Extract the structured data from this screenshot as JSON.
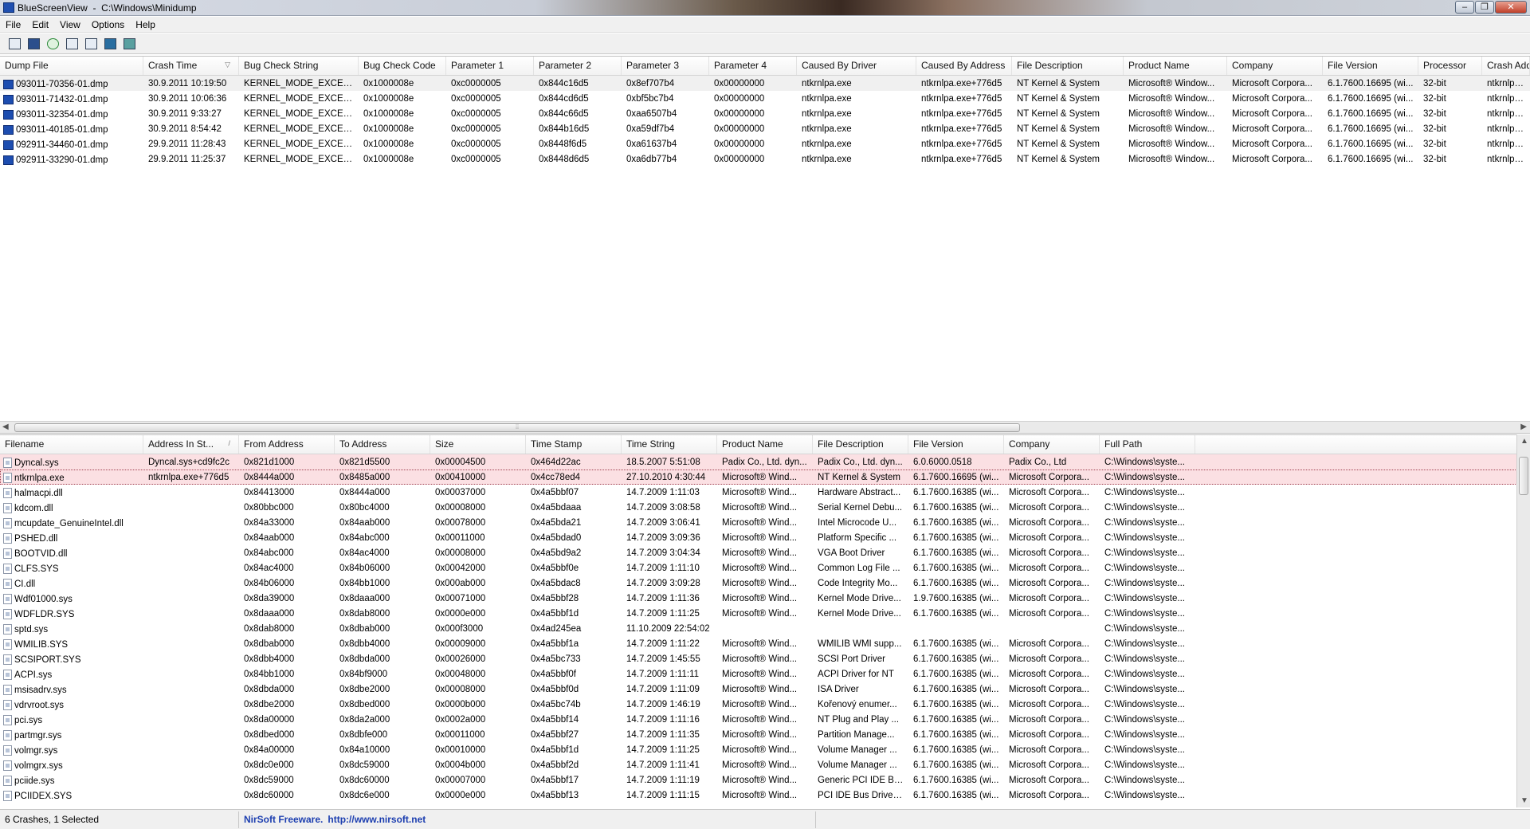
{
  "window": {
    "title": "BlueScreenView  -  C:\\Windows\\Minidump",
    "minimize": "‒",
    "maximize": "❐",
    "close": "✕"
  },
  "menu": [
    "File",
    "Edit",
    "View",
    "Options",
    "Help"
  ],
  "toolbar": [
    "open-folder-icon",
    "save-icon",
    "refresh-icon",
    "copy-icon",
    "properties-icon",
    "html-report-icon",
    "exit-icon"
  ],
  "upper": {
    "columns": [
      "Dump File",
      "Crash Time",
      "Bug Check String",
      "Bug Check Code",
      "Parameter 1",
      "Parameter 2",
      "Parameter 3",
      "Parameter 4",
      "Caused By Driver",
      "Caused By Address",
      "File Description",
      "Product Name",
      "Company",
      "File Version",
      "Processor",
      "Crash Add"
    ],
    "sort_arrow": "▽",
    "rows": [
      [
        "093011-70356-01.dmp",
        "30.9.2011 10:19:50",
        "KERNEL_MODE_EXCEPTI...",
        "0x1000008e",
        "0xc0000005",
        "0x844c16d5",
        "0x8ef707b4",
        "0x00000000",
        "ntkrnlpa.exe",
        "ntkrnlpa.exe+776d5",
        "NT Kernel & System",
        "Microsoft® Window...",
        "Microsoft Corpora...",
        "6.1.7600.16695 (wi...",
        "32-bit",
        "ntkrnlpa.e"
      ],
      [
        "093011-71432-01.dmp",
        "30.9.2011 10:06:36",
        "KERNEL_MODE_EXCEPTI...",
        "0x1000008e",
        "0xc0000005",
        "0x844cd6d5",
        "0xbf5bc7b4",
        "0x00000000",
        "ntkrnlpa.exe",
        "ntkrnlpa.exe+776d5",
        "NT Kernel & System",
        "Microsoft® Window...",
        "Microsoft Corpora...",
        "6.1.7600.16695 (wi...",
        "32-bit",
        "ntkrnlpa.e"
      ],
      [
        "093011-32354-01.dmp",
        "30.9.2011 9:33:27",
        "KERNEL_MODE_EXCEPTI...",
        "0x1000008e",
        "0xc0000005",
        "0x844c66d5",
        "0xaa6507b4",
        "0x00000000",
        "ntkrnlpa.exe",
        "ntkrnlpa.exe+776d5",
        "NT Kernel & System",
        "Microsoft® Window...",
        "Microsoft Corpora...",
        "6.1.7600.16695 (wi...",
        "32-bit",
        "ntkrnlpa.e"
      ],
      [
        "093011-40185-01.dmp",
        "30.9.2011 8:54:42",
        "KERNEL_MODE_EXCEPTI...",
        "0x1000008e",
        "0xc0000005",
        "0x844b16d5",
        "0xa59df7b4",
        "0x00000000",
        "ntkrnlpa.exe",
        "ntkrnlpa.exe+776d5",
        "NT Kernel & System",
        "Microsoft® Window...",
        "Microsoft Corpora...",
        "6.1.7600.16695 (wi...",
        "32-bit",
        "ntkrnlpa.e"
      ],
      [
        "092911-34460-01.dmp",
        "29.9.2011 11:28:43",
        "KERNEL_MODE_EXCEPTI...",
        "0x1000008e",
        "0xc0000005",
        "0x8448f6d5",
        "0xa61637b4",
        "0x00000000",
        "ntkrnlpa.exe",
        "ntkrnlpa.exe+776d5",
        "NT Kernel & System",
        "Microsoft® Window...",
        "Microsoft Corpora...",
        "6.1.7600.16695 (wi...",
        "32-bit",
        "ntkrnlpa.e"
      ],
      [
        "092911-33290-01.dmp",
        "29.9.2011 11:25:37",
        "KERNEL_MODE_EXCEPTI...",
        "0x1000008e",
        "0xc0000005",
        "0x8448d6d5",
        "0xa6db77b4",
        "0x00000000",
        "ntkrnlpa.exe",
        "ntkrnlpa.exe+776d5",
        "NT Kernel & System",
        "Microsoft® Window...",
        "Microsoft Corpora...",
        "6.1.7600.16695 (wi...",
        "32-bit",
        "ntkrnlpa.e"
      ]
    ]
  },
  "lower": {
    "columns": [
      "Filename",
      "Address In St...",
      "From Address",
      "To Address",
      "Size",
      "Time Stamp",
      "Time String",
      "Product Name",
      "File Description",
      "File Version",
      "Company",
      "Full Path"
    ],
    "sort_arrow": "/",
    "rows": [
      [
        "Dyncal.sys",
        "Dyncal.sys+cd9fc2c",
        "0x821d1000",
        "0x821d5500",
        "0x00004500",
        "0x464d22ac",
        "18.5.2007 5:51:08",
        "Padix Co., Ltd. dyn...",
        "Padix Co., Ltd. dyn...",
        "6.0.6000.0518",
        "Padix Co., Ltd",
        "C:\\Windows\\syste..."
      ],
      [
        "ntkrnlpa.exe",
        "ntkrnlpa.exe+776d5",
        "0x8444a000",
        "0x8485a000",
        "0x00410000",
        "0x4cc78ed4",
        "27.10.2010 4:30:44",
        "Microsoft® Wind...",
        "NT Kernel & System",
        "6.1.7600.16695 (wi...",
        "Microsoft Corpora...",
        "C:\\Windows\\syste..."
      ],
      [
        "halmacpi.dll",
        "",
        "0x84413000",
        "0x8444a000",
        "0x00037000",
        "0x4a5bbf07",
        "14.7.2009 1:11:03",
        "Microsoft® Wind...",
        "Hardware Abstract...",
        "6.1.7600.16385 (wi...",
        "Microsoft Corpora...",
        "C:\\Windows\\syste..."
      ],
      [
        "kdcom.dll",
        "",
        "0x80bbc000",
        "0x80bc4000",
        "0x00008000",
        "0x4a5bdaaa",
        "14.7.2009 3:08:58",
        "Microsoft® Wind...",
        "Serial Kernel Debu...",
        "6.1.7600.16385 (wi...",
        "Microsoft Corpora...",
        "C:\\Windows\\syste..."
      ],
      [
        "mcupdate_GenuineIntel.dll",
        "",
        "0x84a33000",
        "0x84aab000",
        "0x00078000",
        "0x4a5bda21",
        "14.7.2009 3:06:41",
        "Microsoft® Wind...",
        "Intel Microcode U...",
        "6.1.7600.16385 (wi...",
        "Microsoft Corpora...",
        "C:\\Windows\\syste..."
      ],
      [
        "PSHED.dll",
        "",
        "0x84aab000",
        "0x84abc000",
        "0x00011000",
        "0x4a5bdad0",
        "14.7.2009 3:09:36",
        "Microsoft® Wind...",
        "Platform Specific ...",
        "6.1.7600.16385 (wi...",
        "Microsoft Corpora...",
        "C:\\Windows\\syste..."
      ],
      [
        "BOOTVID.dll",
        "",
        "0x84abc000",
        "0x84ac4000",
        "0x00008000",
        "0x4a5bd9a2",
        "14.7.2009 3:04:34",
        "Microsoft® Wind...",
        "VGA Boot Driver",
        "6.1.7600.16385 (wi...",
        "Microsoft Corpora...",
        "C:\\Windows\\syste..."
      ],
      [
        "CLFS.SYS",
        "",
        "0x84ac4000",
        "0x84b06000",
        "0x00042000",
        "0x4a5bbf0e",
        "14.7.2009 1:11:10",
        "Microsoft® Wind...",
        "Common Log File ...",
        "6.1.7600.16385 (wi...",
        "Microsoft Corpora...",
        "C:\\Windows\\syste..."
      ],
      [
        "CI.dll",
        "",
        "0x84b06000",
        "0x84bb1000",
        "0x000ab000",
        "0x4a5bdac8",
        "14.7.2009 3:09:28",
        "Microsoft® Wind...",
        "Code Integrity Mo...",
        "6.1.7600.16385 (wi...",
        "Microsoft Corpora...",
        "C:\\Windows\\syste..."
      ],
      [
        "Wdf01000.sys",
        "",
        "0x8da39000",
        "0x8daaa000",
        "0x00071000",
        "0x4a5bbf28",
        "14.7.2009 1:11:36",
        "Microsoft® Wind...",
        "Kernel Mode Drive...",
        "1.9.7600.16385 (wi...",
        "Microsoft Corpora...",
        "C:\\Windows\\syste..."
      ],
      [
        "WDFLDR.SYS",
        "",
        "0x8daaa000",
        "0x8dab8000",
        "0x0000e000",
        "0x4a5bbf1d",
        "14.7.2009 1:11:25",
        "Microsoft® Wind...",
        "Kernel Mode Drive...",
        "6.1.7600.16385 (wi...",
        "Microsoft Corpora...",
        "C:\\Windows\\syste..."
      ],
      [
        "sptd.sys",
        "",
        "0x8dab8000",
        "0x8dbab000",
        "0x000f3000",
        "0x4ad245ea",
        "11.10.2009 22:54:02",
        "",
        "",
        "",
        "",
        "C:\\Windows\\syste..."
      ],
      [
        "WMILIB.SYS",
        "",
        "0x8dbab000",
        "0x8dbb4000",
        "0x00009000",
        "0x4a5bbf1a",
        "14.7.2009 1:11:22",
        "Microsoft® Wind...",
        "WMILIB WMI supp...",
        "6.1.7600.16385 (wi...",
        "Microsoft Corpora...",
        "C:\\Windows\\syste..."
      ],
      [
        "SCSIPORT.SYS",
        "",
        "0x8dbb4000",
        "0x8dbda000",
        "0x00026000",
        "0x4a5bc733",
        "14.7.2009 1:45:55",
        "Microsoft® Wind...",
        "SCSI Port Driver",
        "6.1.7600.16385 (wi...",
        "Microsoft Corpora...",
        "C:\\Windows\\syste..."
      ],
      [
        "ACPI.sys",
        "",
        "0x84bb1000",
        "0x84bf9000",
        "0x00048000",
        "0x4a5bbf0f",
        "14.7.2009 1:11:11",
        "Microsoft® Wind...",
        "ACPI Driver for NT",
        "6.1.7600.16385 (wi...",
        "Microsoft Corpora...",
        "C:\\Windows\\syste..."
      ],
      [
        "msisadrv.sys",
        "",
        "0x8dbda000",
        "0x8dbe2000",
        "0x00008000",
        "0x4a5bbf0d",
        "14.7.2009 1:11:09",
        "Microsoft® Wind...",
        "ISA Driver",
        "6.1.7600.16385 (wi...",
        "Microsoft Corpora...",
        "C:\\Windows\\syste..."
      ],
      [
        "vdrvroot.sys",
        "",
        "0x8dbe2000",
        "0x8dbed000",
        "0x0000b000",
        "0x4a5bc74b",
        "14.7.2009 1:46:19",
        "Microsoft® Wind...",
        "Kořenový enumer...",
        "6.1.7600.16385 (wi...",
        "Microsoft Corpora...",
        "C:\\Windows\\syste..."
      ],
      [
        "pci.sys",
        "",
        "0x8da00000",
        "0x8da2a000",
        "0x0002a000",
        "0x4a5bbf14",
        "14.7.2009 1:11:16",
        "Microsoft® Wind...",
        "NT Plug and Play ...",
        "6.1.7600.16385 (wi...",
        "Microsoft Corpora...",
        "C:\\Windows\\syste..."
      ],
      [
        "partmgr.sys",
        "",
        "0x8dbed000",
        "0x8dbfe000",
        "0x00011000",
        "0x4a5bbf27",
        "14.7.2009 1:11:35",
        "Microsoft® Wind...",
        "Partition Manage...",
        "6.1.7600.16385 (wi...",
        "Microsoft Corpora...",
        "C:\\Windows\\syste..."
      ],
      [
        "volmgr.sys",
        "",
        "0x84a00000",
        "0x84a10000",
        "0x00010000",
        "0x4a5bbf1d",
        "14.7.2009 1:11:25",
        "Microsoft® Wind...",
        "Volume Manager ...",
        "6.1.7600.16385 (wi...",
        "Microsoft Corpora...",
        "C:\\Windows\\syste..."
      ],
      [
        "volmgrx.sys",
        "",
        "0x8dc0e000",
        "0x8dc59000",
        "0x0004b000",
        "0x4a5bbf2d",
        "14.7.2009 1:11:41",
        "Microsoft® Wind...",
        "Volume Manager ...",
        "6.1.7600.16385 (wi...",
        "Microsoft Corpora...",
        "C:\\Windows\\syste..."
      ],
      [
        "pciide.sys",
        "",
        "0x8dc59000",
        "0x8dc60000",
        "0x00007000",
        "0x4a5bbf17",
        "14.7.2009 1:11:19",
        "Microsoft® Wind...",
        "Generic PCI IDE Bu...",
        "6.1.7600.16385 (wi...",
        "Microsoft Corpora...",
        "C:\\Windows\\syste..."
      ],
      [
        "PCIIDEX.SYS",
        "",
        "0x8dc60000",
        "0x8dc6e000",
        "0x0000e000",
        "0x4a5bbf13",
        "14.7.2009 1:11:15",
        "Microsoft® Wind...",
        "PCI IDE Bus Driver ...",
        "6.1.7600.16385 (wi...",
        "Microsoft Corpora...",
        "C:\\Windows\\syste..."
      ]
    ]
  },
  "status": {
    "count": "6 Crashes, 1 Selected",
    "brand": "NirSoft Freeware.",
    "url": "http://www.nirsoft.net"
  },
  "colors": {
    "highlight_row": "#fbe0e3",
    "selected_row": "#f0f0f0",
    "link": "#1d3fb0"
  }
}
